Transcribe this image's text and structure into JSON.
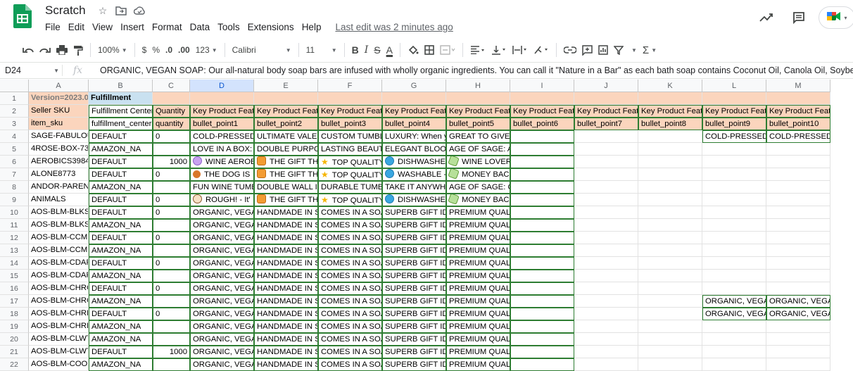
{
  "app": {
    "title": "Scratch"
  },
  "menu": [
    "File",
    "Edit",
    "View",
    "Insert",
    "Format",
    "Data",
    "Tools",
    "Extensions",
    "Help"
  ],
  "last_edit": "Last edit was 2 minutes ago",
  "toolbar": {
    "zoom": "100%",
    "currency": "$",
    "percent": "%",
    "decimal_decrease": ".0",
    "decimal_increase": ".00",
    "number_format": "123",
    "font": "Calibri",
    "font_size": "11",
    "bold": "B",
    "italic": "I",
    "text_color": "A",
    "sum": "Σ"
  },
  "formula_bar": {
    "cell_ref": "D24",
    "fx": "fx",
    "content": "ORGANIC, VEGAN SOAP: Our all-natural body soap bars are infused with wholly organic ingredients. You can call it \"Nature in a Bar\" as each bath soap contains Coconut Oil, Canola Oil, Soybean Oil, Shea Butter"
  },
  "columns": [
    "A",
    "B",
    "C",
    "D",
    "E",
    "F",
    "G",
    "H",
    "I",
    "J",
    "K",
    "L",
    "M"
  ],
  "selected_column": "D",
  "rows": [
    {
      "n": "1",
      "cells": [
        "Version=2023.0",
        "Fulfillment",
        "",
        "",
        "",
        "",
        "",
        "",
        "",
        "",
        "",
        "",
        ""
      ]
    },
    {
      "n": "2",
      "cells": [
        "Seller SKU",
        "Fulfillment Center",
        "Quantity",
        "Key Product Features",
        "Key Product Features",
        "Key Product Features",
        "Key Product Features",
        "Key Product Features",
        "Key Product Features",
        "Key Product Features",
        "Key Product Features",
        "Key Product Features",
        "Key Product Features"
      ]
    },
    {
      "n": "3",
      "cells": [
        "item_sku",
        "fulfillment_center",
        "quantity",
        "bullet_point1",
        "bullet_point2",
        "bullet_point3",
        "bullet_point4",
        "bullet_point5",
        "bullet_point6",
        "bullet_point7",
        "bullet_point8",
        "bullet_point9",
        "bullet_point10"
      ]
    },
    {
      "n": "4",
      "cells": [
        "SAGE-FABULOUS",
        "DEFAULT",
        "0",
        "COLD-PRESSED A",
        "ULTIMATE VALENTINE",
        "CUSTOM TUMBLER",
        "LUXURY: When y",
        "GREAT TO GIVE:",
        "",
        "",
        "",
        "COLD-PRESSED A",
        "COLD-PRESSED A"
      ]
    },
    {
      "n": "5",
      "cells": [
        "4ROSE-BOX-7321",
        "AMAZON_NA",
        "",
        "LOVE IN A BOX:",
        "DOUBLE PURPOSE",
        "LASTING BEAUTY",
        "ELEGANT BLOOM",
        "AGE OF SAGE: A",
        "",
        "",
        "",
        "",
        ""
      ]
    },
    {
      "n": "6",
      "cells": [
        "AEROBICS3984",
        "DEFAULT",
        "1000",
        "WINE AEROBICS",
        "THE GIFT THAT",
        "TOP QUALITY",
        "DISHWASHER",
        "WINE LOVER",
        "",
        "",
        "",
        "",
        ""
      ]
    },
    {
      "n": "7",
      "cells": [
        "ALONE8773",
        "DEFAULT",
        "0",
        "THE DOG IS",
        "THE GIFT THAT",
        "TOP QUALITY",
        "WASHABLE -",
        "MONEY BACK",
        "",
        "",
        "",
        "",
        ""
      ]
    },
    {
      "n": "8",
      "cells": [
        "ANDOR-PARENT",
        "AMAZON_NA",
        "",
        "FUN WINE TUMBLER",
        "DOUBLE WALL IN",
        "DURABLE TUMBLER",
        "TAKE IT ANYWHERE",
        "AGE OF SAGE: O",
        "",
        "",
        "",
        "",
        ""
      ]
    },
    {
      "n": "9",
      "cells": [
        "ANIMALS",
        "DEFAULT",
        "0",
        "ROUGH! - It'",
        "THE GIFT THAT",
        "TOP QUALITY",
        "DISHWASHER",
        "MONEY BACK",
        "",
        "",
        "",
        "",
        ""
      ]
    },
    {
      "n": "10",
      "cells": [
        "AOS-BLM-BLKS",
        "DEFAULT",
        "0",
        "ORGANIC, VEGAN",
        "HANDMADE IN S",
        "COMES IN A SOAP",
        "SUPERB GIFT IDEA",
        "PREMIUM QUALITY",
        "",
        "",
        "",
        "",
        ""
      ]
    },
    {
      "n": "11",
      "cells": [
        "AOS-BLM-BLKS",
        "AMAZON_NA",
        "",
        "ORGANIC, VEGAN",
        "HANDMADE IN S",
        "COMES IN A SOAP",
        "SUPERB GIFT IDEA",
        "PREMIUM QUALITY",
        "",
        "",
        "",
        "",
        ""
      ]
    },
    {
      "n": "12",
      "cells": [
        "AOS-BLM-CCMI",
        "DEFAULT",
        "0",
        "ORGANIC, VEGAN",
        "HANDMADE IN S",
        "COMES IN A SOAP",
        "SUPERB GIFT IDEA",
        "PREMIUM QUALITY",
        "",
        "",
        "",
        "",
        ""
      ]
    },
    {
      "n": "13",
      "cells": [
        "AOS-BLM-CCMI",
        "AMAZON_NA",
        "",
        "ORGANIC, VEGAN",
        "HANDMADE IN S",
        "COMES IN A SOAP",
        "SUPERB GIFT IDEA",
        "PREMIUM QUALITY",
        "",
        "",
        "",
        "",
        ""
      ]
    },
    {
      "n": "14",
      "cells": [
        "AOS-BLM-CDAF",
        "DEFAULT",
        "0",
        "ORGANIC, VEGAN",
        "HANDMADE IN S",
        "COMES IN A SOAP",
        "SUPERB GIFT IDEA",
        "PREMIUM QUALITY",
        "",
        "",
        "",
        "",
        ""
      ]
    },
    {
      "n": "15",
      "cells": [
        "AOS-BLM-CDAF",
        "AMAZON_NA",
        "",
        "ORGANIC, VEGAN",
        "HANDMADE IN S",
        "COMES IN A SOAP",
        "SUPERB GIFT IDEA",
        "PREMIUM QUALITY",
        "",
        "",
        "",
        "",
        ""
      ]
    },
    {
      "n": "16",
      "cells": [
        "AOS-BLM-CHRO",
        "DEFAULT",
        "0",
        "ORGANIC, VEGAN",
        "HANDMADE IN S",
        "COMES IN A SOAP",
        "SUPERB GIFT IDEA",
        "PREMIUM QUALITY",
        "",
        "",
        "",
        "",
        ""
      ]
    },
    {
      "n": "17",
      "cells": [
        "AOS-BLM-CHRO",
        "AMAZON_NA",
        "",
        "ORGANIC, VEGAN",
        "HANDMADE IN S",
        "COMES IN A SOAP",
        "SUPERB GIFT IDEA",
        "PREMIUM QUALITY",
        "",
        "",
        "",
        "ORGANIC, VEGAN",
        "ORGANIC, VEGAN"
      ]
    },
    {
      "n": "18",
      "cells": [
        "AOS-BLM-CHRF",
        "DEFAULT",
        "0",
        "ORGANIC, VEGAN",
        "HANDMADE IN S",
        "COMES IN A SOAP",
        "SUPERB GIFT IDEA",
        "PREMIUM QUALITY",
        "",
        "",
        "",
        "ORGANIC, VEGAN",
        "ORGANIC, VEGAN"
      ]
    },
    {
      "n": "19",
      "cells": [
        "AOS-BLM-CHRF",
        "AMAZON_NA",
        "",
        "ORGANIC, VEGAN",
        "HANDMADE IN S",
        "COMES IN A SOAP",
        "SUPERB GIFT IDEA",
        "PREMIUM QUALITY",
        "",
        "",
        "",
        "",
        ""
      ]
    },
    {
      "n": "20",
      "cells": [
        "AOS-BLM-CLWT",
        "AMAZON_NA",
        "",
        "ORGANIC, VEGAN",
        "HANDMADE IN S",
        "COMES IN A SOAP",
        "SUPERB GIFT IDEA",
        "PREMIUM QUALITY",
        "",
        "",
        "",
        "",
        ""
      ]
    },
    {
      "n": "21",
      "cells": [
        "AOS-BLM-CLWT",
        "DEFAULT",
        "1000",
        "ORGANIC, VEGAN",
        "HANDMADE IN S",
        "COMES IN A SOAP",
        "SUPERB GIFT IDEA",
        "PREMIUM QUALITY",
        "",
        "",
        "",
        "",
        ""
      ]
    },
    {
      "n": "22",
      "cells": [
        "AOS-BLM-COOL",
        "AMAZON_NA",
        "",
        "ORGANIC, VEGAN",
        "HANDMADE IN S",
        "COMES IN A SOAP",
        "SUPERB GIFT IDEA",
        "PREMIUM QUALITY",
        "",
        "",
        "",
        "",
        ""
      ]
    }
  ],
  "row_icons": {
    "6": [
      "wine",
      "gift",
      "star",
      "dish",
      "money"
    ],
    "7": [
      "paws",
      "gift",
      "star",
      "dish",
      "money"
    ],
    "9": [
      "dog",
      "gift",
      "star",
      "dish",
      "money"
    ]
  },
  "colors": {
    "header_peach": "#fbd5bd",
    "header_blue": "#c9e1f0",
    "selection": "#d3e3fd",
    "border_green": "#2e7d32"
  }
}
